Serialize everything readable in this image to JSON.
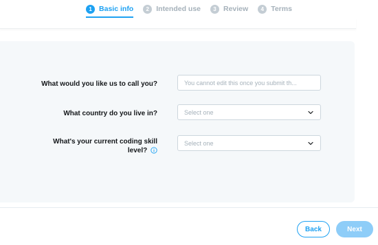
{
  "stepper": {
    "steps": [
      {
        "number": "1",
        "label": "Basic info",
        "active": true
      },
      {
        "number": "2",
        "label": "Intended use",
        "active": false
      },
      {
        "number": "3",
        "label": "Review",
        "active": false
      },
      {
        "number": "4",
        "label": "Terms",
        "active": false
      }
    ]
  },
  "form": {
    "name": {
      "label": "What would you like us to call you?",
      "placeholder": "You cannot edit this once you submit th..."
    },
    "country": {
      "label": "What country do you live in?",
      "value": "Select one"
    },
    "skill": {
      "label_line1": "What's your current coding skill",
      "label_line2": "level?",
      "value": "Select one"
    }
  },
  "footer": {
    "back_label": "Back",
    "next_label": "Next"
  },
  "colors": {
    "accent": "#1da1f2",
    "next_disabled": "#8ecdf8",
    "card_background": "#f5f8fa"
  },
  "icons": {
    "select_arrow": "chevron-down-icon",
    "info": "info-icon"
  }
}
